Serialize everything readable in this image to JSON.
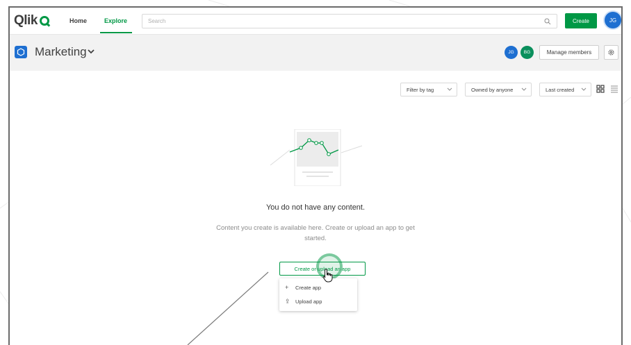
{
  "app": {
    "logo_text": "Qlik",
    "nav": {
      "home": "Home",
      "explore": "Explore"
    },
    "search": {
      "placeholder": "Search"
    },
    "create_label": "Create",
    "user_initials": "JG"
  },
  "space": {
    "title": "Marketing",
    "members": [
      "JG",
      "BG"
    ],
    "manage_members_label": "Manage members"
  },
  "filters": {
    "tag": "Filter by tag",
    "owner": "Owned by anyone",
    "sort": "Last created"
  },
  "empty_state": {
    "title": "You do not have any content.",
    "description": "Content you create is available here. Create or upload an app to get started.",
    "cta_label": "Create or upload an app",
    "menu": {
      "create_app": "Create app",
      "upload_app": "Upload app"
    }
  },
  "colors": {
    "accent": "#009845",
    "blue": "#1e6fd1",
    "member_bg": "#0a8f5c"
  },
  "icons": [
    "search-icon",
    "space-icon",
    "chevron-down-icon",
    "gear-icon",
    "grid-view-icon",
    "list-view-icon",
    "plus-icon",
    "upload-icon",
    "hand-cursor-icon"
  ]
}
